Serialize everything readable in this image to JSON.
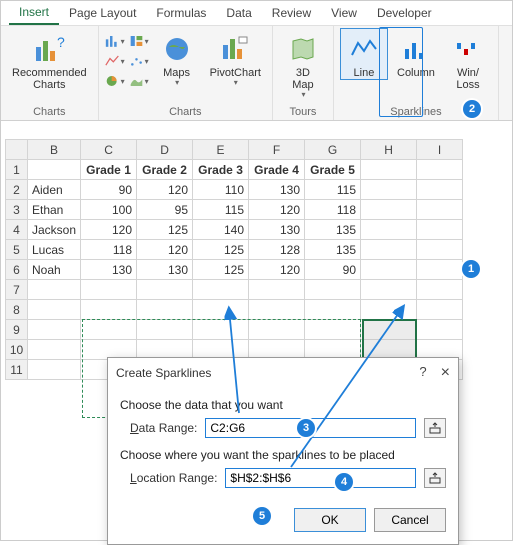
{
  "tabs": [
    "Insert",
    "Page Layout",
    "Formulas",
    "Data",
    "Review",
    "View",
    "Developer"
  ],
  "active_tab": "Insert",
  "ribbon": {
    "recommended_charts": "Recommended\nCharts",
    "charts_group": "Charts",
    "maps": "Maps",
    "pivotchart": "PivotChart",
    "tours_group": "Tours",
    "map3d": "3D\nMap",
    "sparklines_group": "Sparklines",
    "line": "Line",
    "column": "Column",
    "winloss": "Win/\nLoss"
  },
  "columns": [
    "B",
    "C",
    "D",
    "E",
    "F",
    "G",
    "H",
    "I"
  ],
  "row_numbers": [
    "",
    "1",
    "2",
    "3",
    "4",
    "5",
    "6",
    "7",
    "8",
    "9",
    "10",
    "11"
  ],
  "headers": [
    "Grade 1",
    "Grade 2",
    "Grade 3",
    "Grade 4",
    "Grade 5"
  ],
  "rows": [
    {
      "name": "Aiden",
      "v": [
        90,
        120,
        110,
        130,
        115
      ]
    },
    {
      "name": "Ethan",
      "v": [
        100,
        95,
        115,
        120,
        118
      ]
    },
    {
      "name": "Jackson",
      "v": [
        120,
        125,
        140,
        130,
        135
      ]
    },
    {
      "name": "Lucas",
      "v": [
        118,
        120,
        125,
        128,
        135
      ]
    },
    {
      "name": "Noah",
      "v": [
        130,
        130,
        125,
        120,
        90
      ]
    }
  ],
  "dialog": {
    "title": "Create Sparklines",
    "help": "?",
    "close": "×",
    "sec1": "Choose the data that you want",
    "data_label": "Data Range:",
    "data_value": "C2:G6",
    "sec2": "Choose where you want the sparklines to be placed",
    "loc_label": "Location Range:",
    "loc_value": "$H$2:$H$6",
    "ok": "OK",
    "cancel": "Cancel"
  },
  "callouts": {
    "c1": "1",
    "c2": "2",
    "c3": "3",
    "c4": "4",
    "c5": "5"
  }
}
